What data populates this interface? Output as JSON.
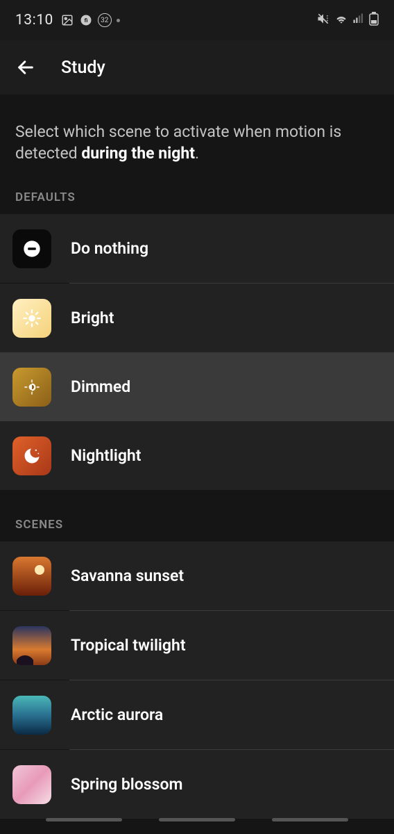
{
  "status": {
    "time": "13:10",
    "badge": "32"
  },
  "header": {
    "title": "Study"
  },
  "instruction": {
    "prefix": "Select which scene to activate when motion is detected ",
    "bold": "during the night",
    "suffix": "."
  },
  "sections": {
    "defaults_label": "DEFAULTS",
    "scenes_label": "SCENES"
  },
  "defaults": [
    {
      "label": "Do nothing",
      "icon": "donothing",
      "selected": false
    },
    {
      "label": "Bright",
      "icon": "bright",
      "selected": false
    },
    {
      "label": "Dimmed",
      "icon": "dimmed",
      "selected": true
    },
    {
      "label": "Nightlight",
      "icon": "nightlight",
      "selected": false
    }
  ],
  "scenes": [
    {
      "label": "Savanna sunset",
      "icon": "savanna"
    },
    {
      "label": "Tropical twilight",
      "icon": "tropical"
    },
    {
      "label": "Arctic aurora",
      "icon": "arctic"
    },
    {
      "label": "Spring blossom",
      "icon": "blossom"
    }
  ]
}
